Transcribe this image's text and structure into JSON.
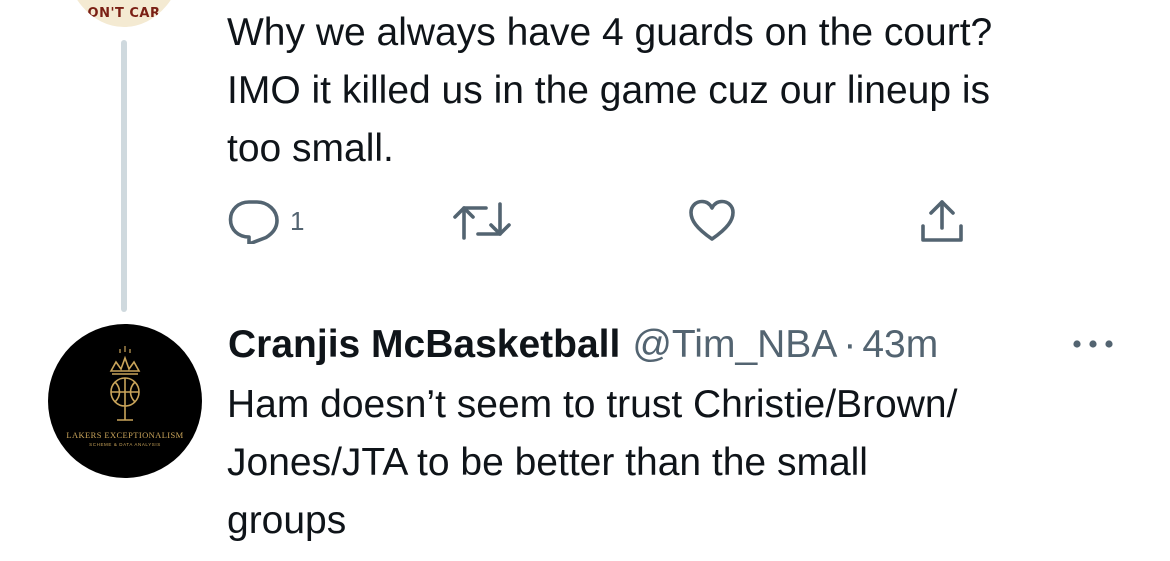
{
  "parent_tweet": {
    "avatar_text": "ON'T CAR",
    "text": "Why we always have 4 guards on the court?\nIMO it killed us in the game cuz our lineup is\ntoo small.",
    "reply_count": "1"
  },
  "reply_tweet": {
    "display_name": "Cranjis McBasketball",
    "handle": "@Tim_NBA",
    "separator": "·",
    "time": "43m",
    "text": "Ham doesn’t seem to trust Christie/Brown/\nJones/JTA to be better than the small\ngroups",
    "avatar": {
      "brand_text": "LAKERS EXCEPTIONALISM",
      "sub_text": "SCHEME & DATA ANALYSIS"
    }
  },
  "icons": {
    "reply": "reply-icon",
    "retweet": "retweet-icon",
    "like": "heart-icon",
    "share": "share-icon",
    "more": "more-horizontal-icon",
    "logo": "crowned-basketball-microphone-icon"
  },
  "colors": {
    "text_primary": "#0f1419",
    "text_secondary": "#536471",
    "thread_line": "#cfd9de",
    "avatar_gold": "#c9a45a"
  }
}
